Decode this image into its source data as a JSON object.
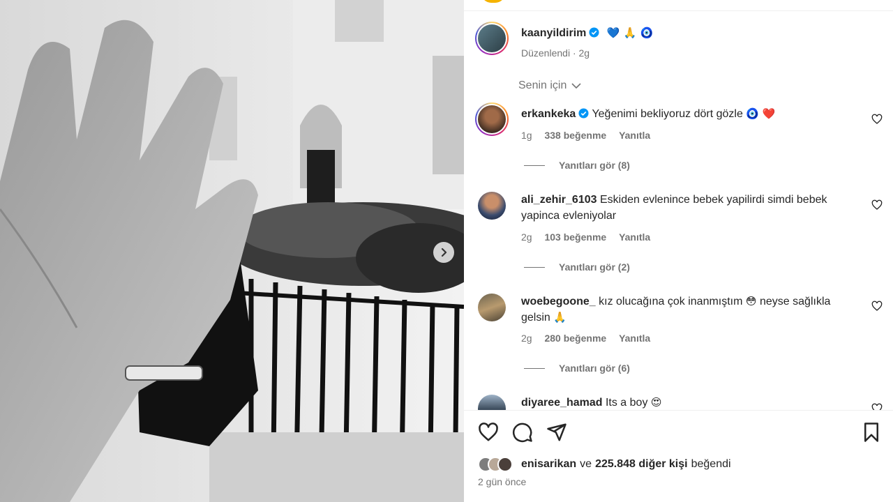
{
  "post": {
    "author": "kaanyildirim",
    "author_emojis": "💙 🙏 🧿",
    "edited_label": "Düzenlendi · 2g"
  },
  "comments_filter": {
    "label": "Senin için"
  },
  "comments": [
    {
      "username": "erkankeka",
      "verified": true,
      "text": "Yeğenimi bekliyoruz dört gözle",
      "emojis": "🧿 ❤️",
      "time": "1g",
      "likes": "338 beğenme",
      "reply": "Yanıtla",
      "view_replies": "Yanıtları gör (8)"
    },
    {
      "username": "ali_zehir_6103",
      "verified": false,
      "text": "Eskiden evlenince bebek yapilirdi simdi bebek yapinca evleniyolar",
      "emojis": "",
      "time": "2g",
      "likes": "103 beğenme",
      "reply": "Yanıtla",
      "view_replies": "Yanıtları gör (2)"
    },
    {
      "username": "woebegoone_",
      "verified": false,
      "text": "kız olucağına çok inanmıştım",
      "text2": "neyse sağlıkla gelsin",
      "emojis": "😳",
      "emojis2": "🙏",
      "time": "2g",
      "likes": "280 beğenme",
      "reply": "Yanıtla",
      "view_replies": "Yanıtları gör (6)"
    },
    {
      "username": "diyaree_hamad",
      "verified": false,
      "text": "Its a boy",
      "emojis": "😍"
    }
  ],
  "likes_summary": {
    "user": "enisarikan",
    "connector": "ve",
    "others": "225.848 diğer kişi",
    "suffix": "beğendi"
  },
  "posted_ago": "2 gün önce",
  "icons": {
    "like": "heart-icon",
    "comment": "comment-icon",
    "share": "share-icon",
    "save": "bookmark-icon",
    "next": "chevron-right-icon",
    "verified": "verified-badge-icon"
  },
  "colors": {
    "verified_blue": "#0095f6",
    "text": "#262626",
    "muted": "#737373"
  }
}
